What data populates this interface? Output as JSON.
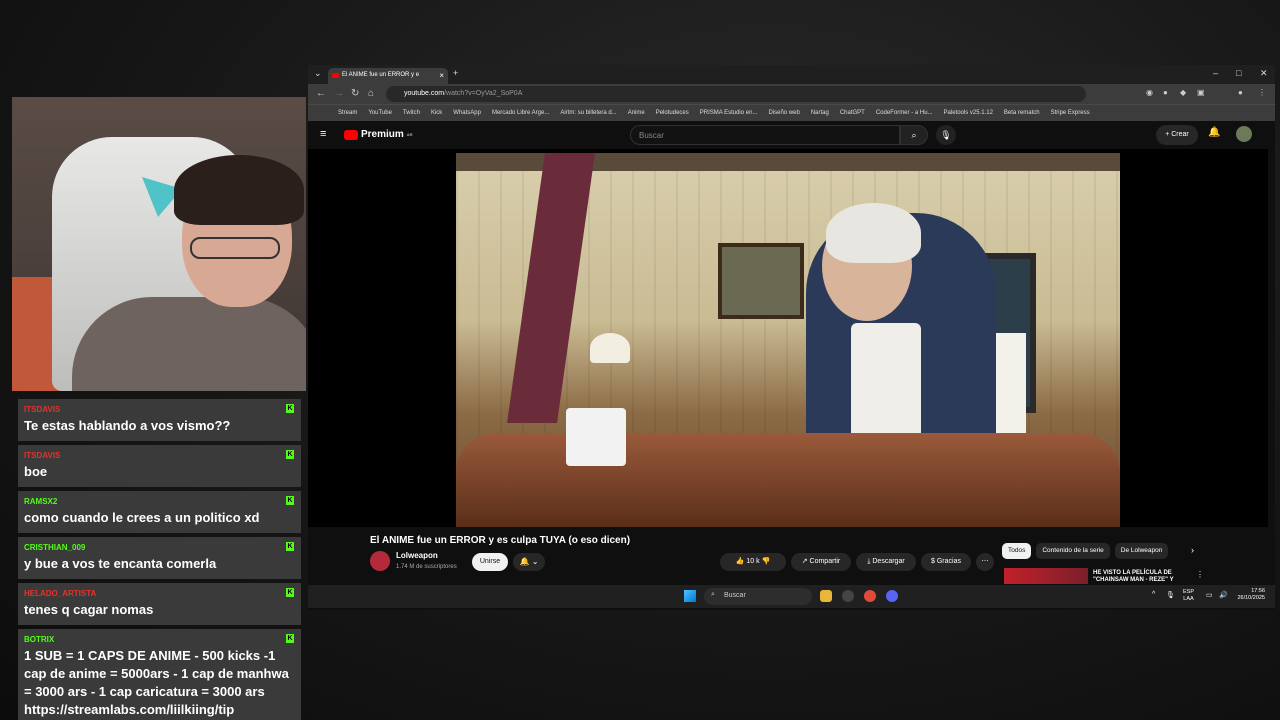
{
  "chat": [
    {
      "user": "ITSDAVIS",
      "user_color": "#e0352b",
      "text": "Te estas hablando a vos vismo??"
    },
    {
      "user": "ITSDAVIS",
      "user_color": "#e0352b",
      "text": "boe"
    },
    {
      "user": "RAMSX2",
      "user_color": "#53fc18",
      "text": "como cuando le crees a un politico xd"
    },
    {
      "user": "CRISTHIAN_009",
      "user_color": "#53fc18",
      "text": "y bue a vos te encanta comerla"
    },
    {
      "user": "HELADO_ARTISTA",
      "user_color": "#e0352b",
      "text": "tenes q cagar nomas"
    },
    {
      "user": "BOTRIX",
      "user_color": "#53fc18",
      "text": "1 SUB = 1 CAPS DE ANIME - 500 kicks -1 cap de anime = 5000ars - 1 cap de manhwa = 3000 ars - 1 cap caricatura = 3000 ars https://streamlabs.com/liilkiing/tip"
    }
  ],
  "browser": {
    "tab_title": "El ANIME fue un ERROR y e",
    "url_domain": "youtube.com",
    "url_path": "/watch?v=OyVa2_SoP0A",
    "bookmarks": [
      "Stream",
      "YouTube",
      "Twitch",
      "Kick",
      "WhatsApp",
      "Mercado Libre Arge...",
      "Airtm: su billetera d...",
      "Anime",
      "Pelotudeces",
      "PRISMA Estudio en...",
      "Diseño web",
      "Nartag",
      "ChatGPT",
      "CodeFormer - a Hu...",
      "Paletools v25.1.12",
      "Beta rematch",
      "Stripe Express"
    ]
  },
  "youtube": {
    "logo_text": "Premium",
    "logo_region": "AR",
    "search_placeholder": "Buscar",
    "create_label": "+ Crear",
    "video_title": "El ANIME fue un ERROR y es culpa TUYA (o eso dicen)",
    "channel_name": "Lolweapon",
    "subscribers": "1.74 M de suscriptores",
    "join_label": "Unirse",
    "likes": "10 k",
    "share_label": "Compartir",
    "download_label": "Descargar",
    "thanks_label": "Gracias",
    "chips": [
      "Todos",
      "Contenido de la serie",
      "De Lolweapon"
    ],
    "reco_title": "HE VISTO LA PELÍCULA DE \"CHAINSAW MAN - REZE\" Y"
  },
  "taskbar": {
    "search_label": "Buscar",
    "lang_top": "ESP",
    "lang_bottom": "LAA",
    "time": "17:56",
    "date": "26/10/2025"
  },
  "colors": {
    "accent": "#ff0000",
    "kick_green": "#53fc18"
  }
}
